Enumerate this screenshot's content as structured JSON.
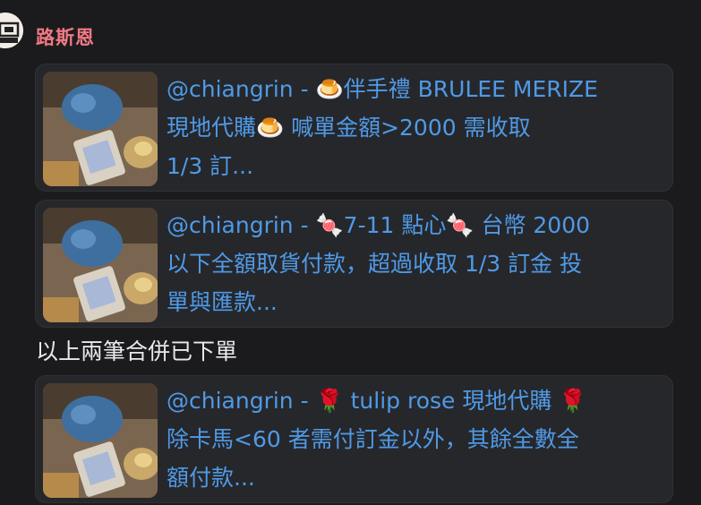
{
  "message": {
    "sender": "路斯恩",
    "avatar_icon": "stamp-avatar-icon"
  },
  "links": [
    {
      "line1": "@chiangrin - 🍮伴手禮 BRULEE MERIZE",
      "line2": "現地代購🍮 喊單金額>2000 需收取",
      "line3": "1/3 訂..."
    },
    {
      "line1": "@chiangrin - 🍬7-11 點心🍬 台幣 2000",
      "line2": "以下全額取貨付款，超過收取 1/3 訂金 投",
      "line3": "單與匯款..."
    },
    {
      "line1": "@chiangrin - 🌹 tulip rose 現地代購 🌹",
      "line2": "除卡馬<60 者需付訂金以外，其餘全數全",
      "line3": "額付款..."
    }
  ],
  "body_text": "以上兩筆合併已下單",
  "colors": {
    "background": "#1b1b1d",
    "sender": "#f07a84",
    "link": "#4f9ae6",
    "card": "#26272b",
    "text": "#e9e9ea"
  }
}
